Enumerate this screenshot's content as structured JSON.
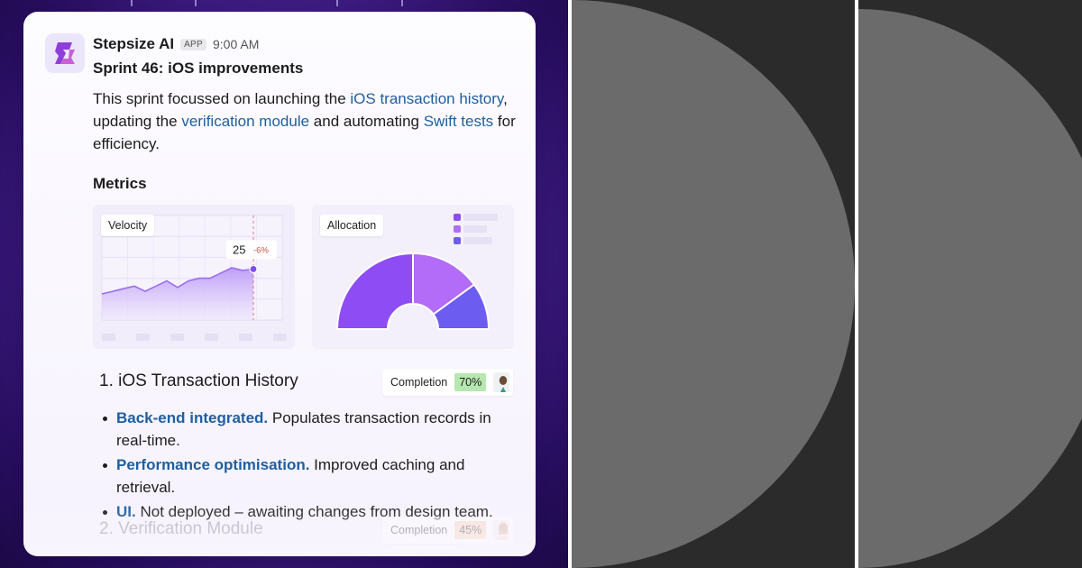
{
  "message": {
    "app_name": "Stepsize AI",
    "badge": "APP",
    "time": "9:00 AM",
    "title": "Sprint 46: iOS improvements",
    "body": {
      "part1": "This sprint focussed on launching the ",
      "link1": "iOS transaction history",
      "part2": ", updating the ",
      "link2": "verification module",
      "part3": " and automating ",
      "link3": "Swift tests",
      "part4": " for efficiency."
    }
  },
  "metrics": {
    "heading": "Metrics",
    "velocity": {
      "label": "Velocity",
      "current_value": "25",
      "change": "-6%"
    },
    "allocation": {
      "label": "Allocation"
    }
  },
  "chart_data": [
    {
      "type": "area",
      "title": "Velocity",
      "x": [
        1,
        2,
        3,
        4,
        5,
        6,
        7,
        8,
        9,
        10,
        11,
        12,
        13,
        14,
        15
      ],
      "values": [
        10,
        11,
        12,
        13,
        11,
        13,
        15,
        12.5,
        15,
        16,
        16,
        18,
        20,
        19,
        19.5
      ],
      "highlight": {
        "label": "25",
        "change": "-6%"
      },
      "ylim": [
        0,
        40
      ],
      "grid": true
    },
    {
      "type": "pie",
      "title": "Allocation",
      "shape": "half-donut",
      "values": [
        50,
        30,
        20
      ],
      "colors": [
        "#8e4cf5",
        "#b26cf7",
        "#6c5cf0"
      ]
    }
  ],
  "sections": [
    {
      "title": "1. iOS Transaction History",
      "completion_label": "Completion",
      "completion_value": "70%",
      "bullets": [
        {
          "head": "Back-end integrated.",
          "text": " Populates transaction records in real-time."
        },
        {
          "head": "Performance optimisation.",
          "text": " Improved caching and retrieval."
        },
        {
          "head": "UI.",
          "text": " Not deployed – awaiting changes from design team."
        }
      ]
    },
    {
      "title": "2. Verification Module",
      "completion_label": "Completion",
      "completion_value": "45%"
    }
  ],
  "colors": {
    "accent_purple": "#8e4cf5",
    "link_blue": "#1f5fa0",
    "completion_green": "#b6e7b0",
    "completion_orange": "#f5cfb0",
    "panel_grey": "#6b6b6b",
    "panel_dark": "#2b2b2b"
  }
}
